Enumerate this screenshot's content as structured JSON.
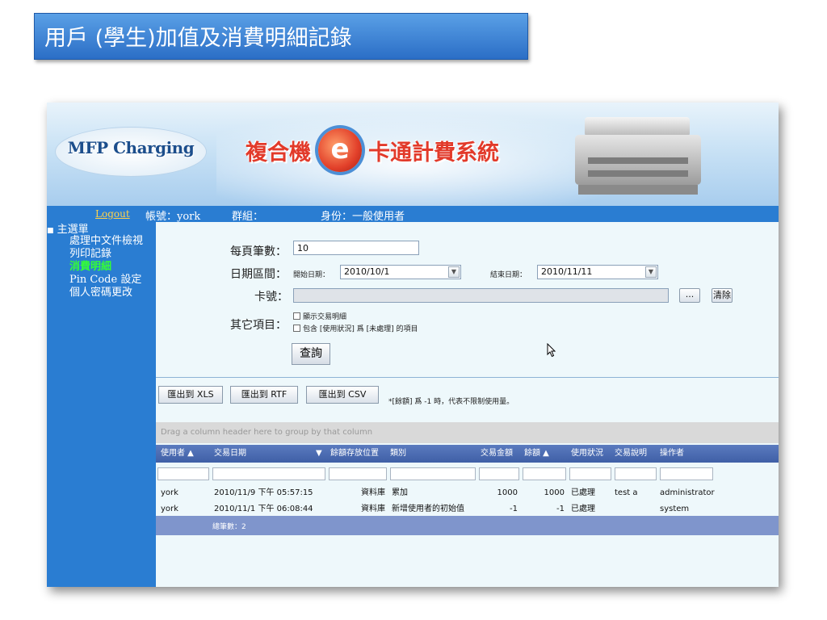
{
  "slide_title": "用戶 (學生)加值及消費明細記錄",
  "banner": {
    "logo_text": "MFP Charging",
    "title_part1": "複合機",
    "e_letter": "e",
    "title_part2": "卡通計費系統"
  },
  "header": {
    "logout": "Logout",
    "account": "帳號：york",
    "group": "群組：",
    "role": "身份：一般使用者"
  },
  "sidebar": {
    "menu_title": "主選單",
    "items": [
      {
        "label": "處理中文件檢視"
      },
      {
        "label": "列印記錄"
      },
      {
        "label": "消費明細"
      },
      {
        "label": "Pin Code 設定"
      },
      {
        "label": "個人密碼更改"
      }
    ]
  },
  "form": {
    "page_size_label": "每頁筆數：",
    "page_size_value": "10",
    "date_range_label": "日期區間：",
    "start_label": "開始日期：",
    "start_value": "2010/10/1",
    "end_label": "結束日期：",
    "end_value": "2010/11/11",
    "card_label": "卡號：",
    "card_value": "",
    "browse_button": "...",
    "clear_button": "清除",
    "other_label": "其它項目：",
    "option1": "顯示交易明細",
    "option2": "包含 [使用狀況] 爲 [未處理] 的項目",
    "query_button": "查詢"
  },
  "export": {
    "xls": "匯出到 XLS",
    "rtf": "匯出到 RTF",
    "csv": "匯出到 CSV",
    "note": "*[餘額] 爲 -1 時，代表不限制使用量。"
  },
  "grid": {
    "group_hint": "Drag a column header here to group by that column",
    "columns": [
      "使用者 ▲",
      "交易日期",
      "▼",
      "餘額存放位置",
      "類別",
      "交易金額",
      "餘額 ▲",
      "使用狀況",
      "交易說明",
      "操作者"
    ],
    "rows": [
      {
        "user": "york",
        "date": "2010/11/9 下午 05:57:15",
        "location": "資料庫",
        "category": "累加",
        "amount": "1000",
        "balance": "1000",
        "status": "已處理",
        "desc": "test a",
        "operator": "administrator"
      },
      {
        "user": "york",
        "date": "2010/11/1 下午 06:08:44",
        "location": "資料庫",
        "category": "新增使用者的初始值",
        "amount": "-1",
        "balance": "-1",
        "status": "已處理",
        "desc": "",
        "operator": "system"
      }
    ],
    "footer": "總筆數：2"
  }
}
